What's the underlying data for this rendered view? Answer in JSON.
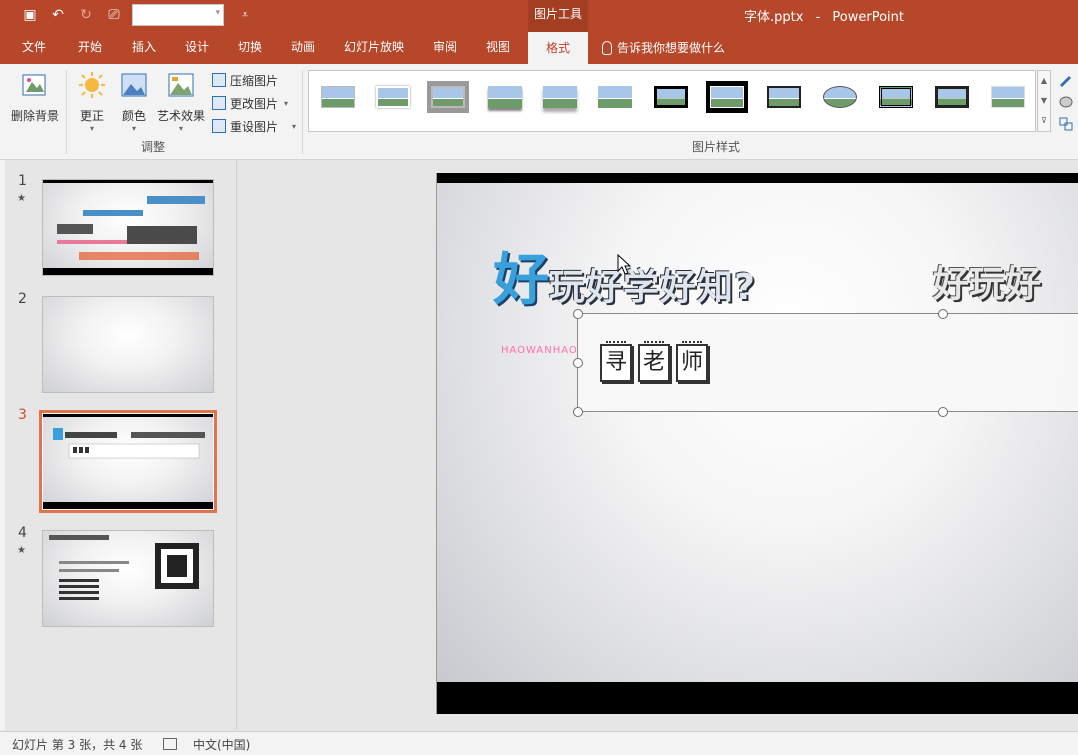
{
  "titlebar": {
    "context_tab": "图片工具",
    "doc_name": "字体.pptx",
    "app_name": "PowerPoint"
  },
  "tabs": [
    {
      "label": "文件"
    },
    {
      "label": "开始"
    },
    {
      "label": "插入"
    },
    {
      "label": "设计"
    },
    {
      "label": "切换"
    },
    {
      "label": "动画"
    },
    {
      "label": "幻灯片放映"
    },
    {
      "label": "审阅"
    },
    {
      "label": "视图"
    },
    {
      "label": "格式"
    }
  ],
  "tellme": "告诉我你想要做什么",
  "ribbon": {
    "remove_bg": "删除背景",
    "correct": "更正",
    "color": "颜色",
    "art_effects": "艺术效果",
    "compress": "压缩图片",
    "change_pic": "更改图片",
    "reset_pic": "重设图片",
    "group_adjust": "调整",
    "group_styles": "图片样式"
  },
  "slides": [
    {
      "num": "1",
      "star": "★"
    },
    {
      "num": "2",
      "star": ""
    },
    {
      "num": "3",
      "star": ""
    },
    {
      "num": "4",
      "star": "★"
    }
  ],
  "slide": {
    "headline_big": "好",
    "headline_rest": "玩好学好知?",
    "headline2": "好玩好",
    "pinyin": "HAOWANHAO",
    "chars": [
      "寻",
      "老",
      "师"
    ]
  },
  "status": {
    "slide_info": "幻灯片 第 3 张，共 4 张",
    "language": "中文(中国)"
  },
  "colors": {
    "accent": "#b7472a",
    "selection": "#e0734f"
  }
}
